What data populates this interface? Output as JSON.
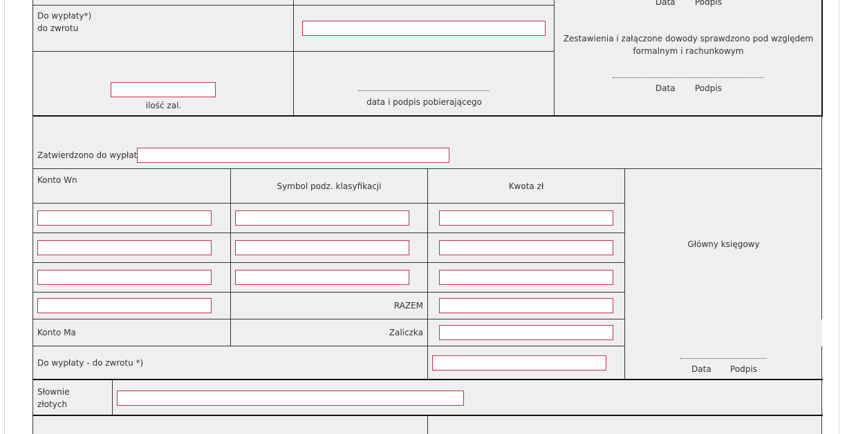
{
  "top_section": {
    "do_wyplaty_label": "Do wypłaty*)",
    "do_zwrotu_label": "do zwrotu",
    "data_label_top": "Data",
    "podpis_label_top": "Podpis",
    "verification_text_line1": "Zestawienia i załączone dowody sprawdzono pod względem",
    "verification_text_line2": "formalnym i rachunkowym",
    "data_label_mid": "Data",
    "podpis_label_mid": "Podpis",
    "ilosc_zal_label": "ilość zal.",
    "data_podpis_pobierajacego_label": "data i podpis pobierającego",
    "amount_value": "",
    "ilosc_zal_value": ""
  },
  "approval": {
    "zatwierdzono_label": "Zatwierdzono do wypłaty",
    "zatwierdzono_value": ""
  },
  "accounting_table": {
    "konto_wn_header": "Konto Wn",
    "symbol_header": "Symbol podz. klasyfikacji",
    "kwota_header": "Kwota zł",
    "rows": [
      {
        "konto": "",
        "symbol": "",
        "kwota": ""
      },
      {
        "konto": "",
        "symbol": "",
        "kwota": ""
      },
      {
        "konto": "",
        "symbol": "",
        "kwota": ""
      }
    ],
    "razem_label": "RAZEM",
    "razem_konto_value": "",
    "razem_kwota_value": "",
    "konto_ma_label": "Konto Ma",
    "zaliczka_label": "Zaliczka",
    "zaliczka_value": "",
    "do_wyplaty_zwrotu_label": "Do wypłaty - do zwrotu *)",
    "do_wyplaty_zwrotu_value": "",
    "glowny_ksiegowy_label": "Główny księgowy",
    "data_label_bottom": "Data",
    "podpis_label_bottom": "Podpis"
  },
  "slownie": {
    "line1": "Słownie",
    "line2": "złotych",
    "value": ""
  }
}
